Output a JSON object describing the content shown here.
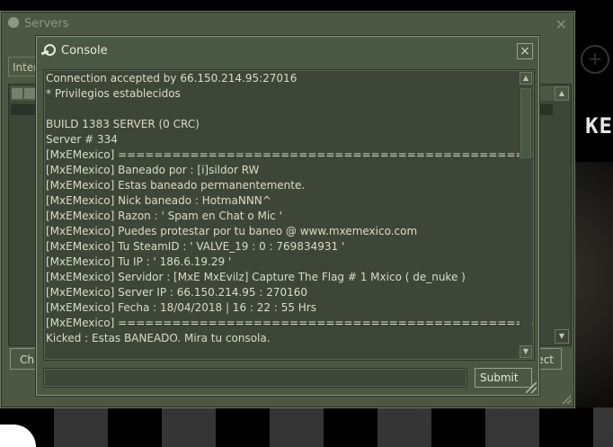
{
  "background": {
    "text": "KE"
  },
  "servers_window": {
    "title": "Servers",
    "close_glyph": "×",
    "tab_label": "Inter",
    "left_button_label": "Cha",
    "right_button_label": "ect"
  },
  "console_window": {
    "title": "Console",
    "close_glyph": "×",
    "output": "Connection accepted by 66.150.214.95:27016\n* Privilegios establecidos\n\nBUILD 1383 SERVER (0 CRC)\nServer # 334\n[MxEMexico] ==============================================\n[MxEMexico] Baneado por : [i]sildor RW\n[MxEMexico] Estas baneado permanentemente.\n[MxEMexico] Nick baneado : HotmaNNN^\n[MxEMexico] Razon : ' Spam en Chat o Mic '\n[MxEMexico] Puedes protestar por tu baneo @ www.mxemexico.com\n[MxEMexico] Tu SteamID : ' VALVE_19 : 0 : 769834931 '\n[MxEMexico] Tu IP : ' 186.6.19.29 '\n[MxEMexico] Servidor : [MxE MxEvilz] Capture The Flag # 1 Mxico ( de_nuke )\n[MxEMexico] Server IP : 66.150.214.95 : 270160\n[MxEMexico] Fecha : 18/04/2018 | 16 : 22 : 55 Hrs\n[MxEMexico] ==============================================\nKicked : Estas BANEADO. Mira tu consola.",
    "input_value": "",
    "submit_label": "Submit",
    "scroll_up_glyph": "▲",
    "scroll_down_glyph": "▼"
  },
  "colors": {
    "window_bg": "#4a5742",
    "panel_bg": "#3e4637",
    "text": "#dcdcc8",
    "border": "#8a9482"
  }
}
